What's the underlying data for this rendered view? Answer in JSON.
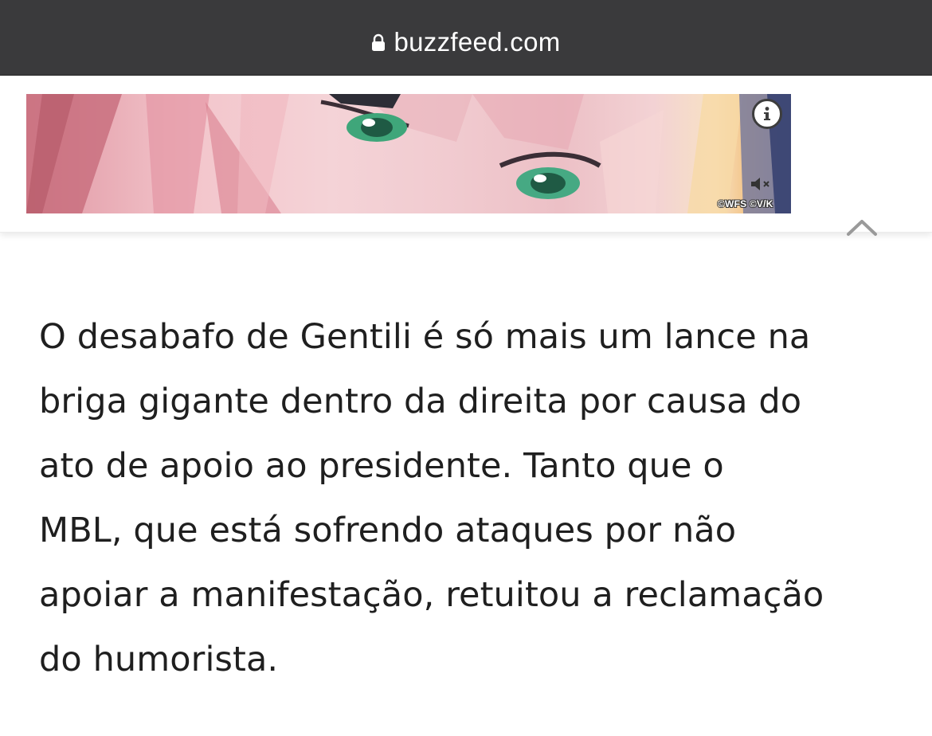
{
  "browser": {
    "url": "buzzfeed.com",
    "lock_icon": "lock-icon",
    "bar_color": "#3a3a3c"
  },
  "ad": {
    "info_icon": "info-icon",
    "mute_icon": "speaker-muted-icon",
    "copyright": "©WFS ©V/K",
    "collapse_icon": "chevron-up-icon"
  },
  "article": {
    "lines": [
      "O desabafo de Gentili é só mais um lance na",
      "briga gigante dentro da direita por causa do",
      "ato de apoio ao presidente. Tanto que o",
      "MBL, que está sofrendo ataques por não",
      "apoiar a manifestação, retuitou a reclamação",
      "do humorista."
    ]
  }
}
